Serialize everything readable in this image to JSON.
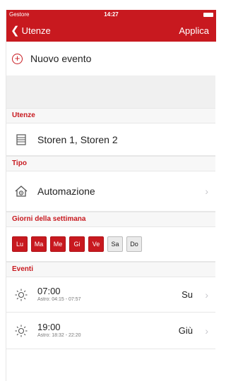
{
  "status": {
    "carrier": "Gestore",
    "time": "14:27"
  },
  "nav": {
    "back_label": "Utenze",
    "apply_label": "Applica"
  },
  "new_event": {
    "label": "Nuovo evento"
  },
  "sections": {
    "utenze": "Utenze",
    "tipo": "Tipo",
    "giorni": "Giorni della settimana",
    "eventi": "Eventi"
  },
  "utenze": {
    "value": "Storen 1, Storen 2"
  },
  "tipo": {
    "value": "Automazione"
  },
  "days": [
    {
      "label": "Lu",
      "selected": true
    },
    {
      "label": "Ma",
      "selected": true
    },
    {
      "label": "Me",
      "selected": true
    },
    {
      "label": "Gi",
      "selected": true
    },
    {
      "label": "Ve",
      "selected": true
    },
    {
      "label": "Sa",
      "selected": false
    },
    {
      "label": "Do",
      "selected": false
    }
  ],
  "events": [
    {
      "time": "07:00",
      "astro": "Astro: 04:15 - 07:57",
      "direction": "Su"
    },
    {
      "time": "19:00",
      "astro": "Astro: 18:32 - 22:20",
      "direction": "Giù"
    }
  ],
  "colors": {
    "accent": "#c8191f",
    "section_bg": "#f7f7f7"
  },
  "icons": {
    "back": "chevron-left-icon",
    "add": "plus-circle-icon",
    "devices": "list-icon",
    "type": "home-gear-icon",
    "event": "sun-icon",
    "row": "chevron-right-icon"
  }
}
